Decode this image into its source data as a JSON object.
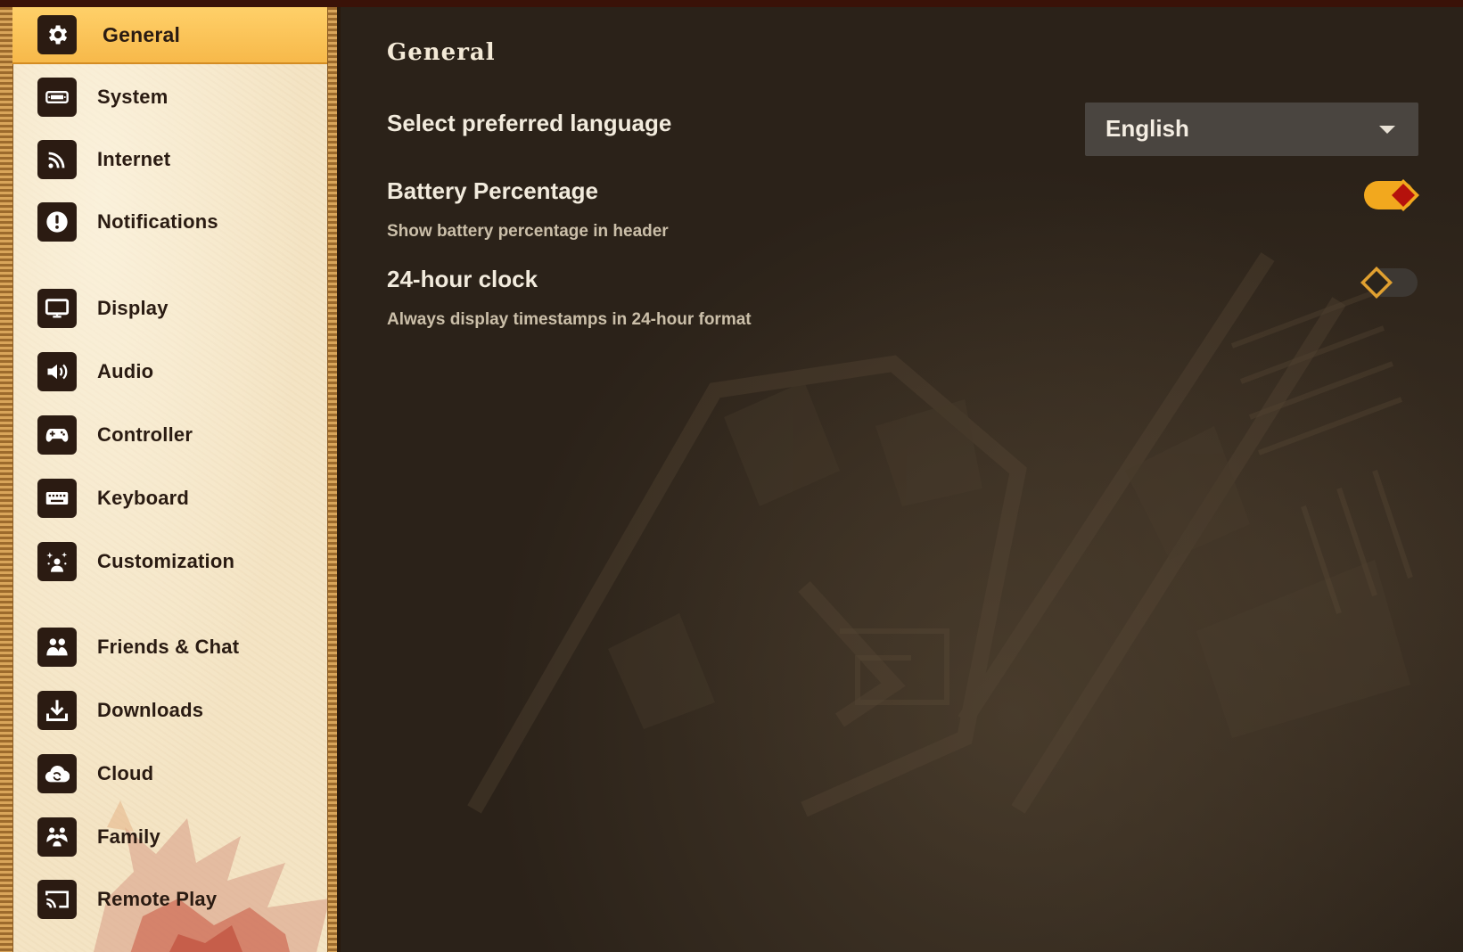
{
  "sidebar": {
    "items": [
      {
        "label": "General",
        "icon": "gear-icon",
        "active": true
      },
      {
        "label": "System",
        "icon": "console-icon"
      },
      {
        "label": "Internet",
        "icon": "wifi-icon"
      },
      {
        "label": "Notifications",
        "icon": "alert-icon"
      },
      {
        "label": "Display",
        "icon": "monitor-icon"
      },
      {
        "label": "Audio",
        "icon": "speaker-icon"
      },
      {
        "label": "Controller",
        "icon": "gamepad-icon"
      },
      {
        "label": "Keyboard",
        "icon": "keyboard-icon"
      },
      {
        "label": "Customization",
        "icon": "sparkle-person-icon"
      },
      {
        "label": "Friends & Chat",
        "icon": "people-icon"
      },
      {
        "label": "Downloads",
        "icon": "download-icon"
      },
      {
        "label": "Cloud",
        "icon": "cloud-sync-icon"
      },
      {
        "label": "Family",
        "icon": "family-icon"
      },
      {
        "label": "Remote Play",
        "icon": "cast-icon"
      }
    ]
  },
  "main": {
    "title": "General",
    "language": {
      "label": "Select preferred language",
      "value": "English"
    },
    "battery": {
      "label": "Battery Percentage",
      "description": "Show battery percentage in header",
      "enabled": true
    },
    "clock": {
      "label": "24-hour clock",
      "description": "Always display timestamps in 24-hour format",
      "enabled": false
    }
  },
  "colors": {
    "accent": "#f7b94a",
    "toggle_on_track": "#f2a81e",
    "toggle_on_thumb": "#b5120c",
    "toggle_off_track": "#3d3833",
    "sidebar_bg": "#f4e4c4",
    "main_bg": "#2b2219"
  }
}
